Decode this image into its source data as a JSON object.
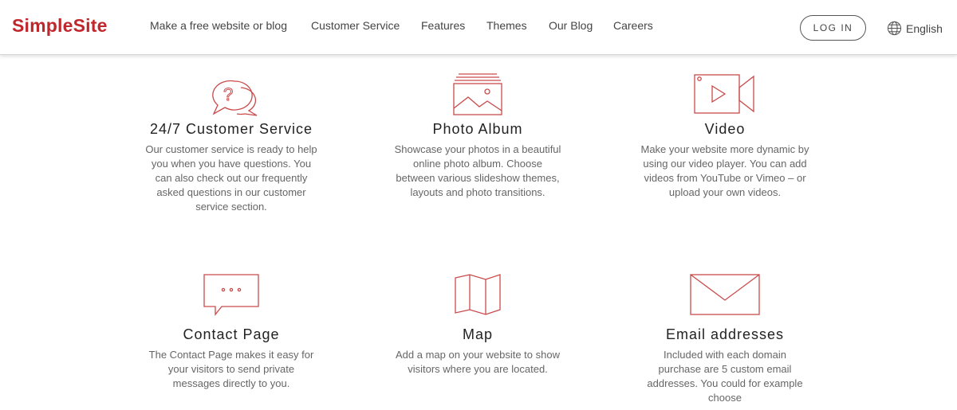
{
  "header": {
    "logo": "SimpleSite",
    "nav": [
      "Make a free website or blog",
      "Customer Service",
      "Features",
      "Themes",
      "Our Blog",
      "Careers"
    ],
    "login_label": "LOG IN",
    "language": "English"
  },
  "features": [
    {
      "icon": "speech-bubbles-question-icon",
      "title": "24/7 Customer Service",
      "description": "Our customer service is ready to help you when you have questions. You can also check out our frequently asked questions in our customer service section."
    },
    {
      "icon": "photo-album-icon",
      "title": "Photo Album",
      "description": "Showcase your photos in a beautiful online photo album. Choose between various slideshow themes, layouts and photo transitions."
    },
    {
      "icon": "video-camera-icon",
      "title": "Video",
      "description": "Make your website more dynamic by using our video player. You can add videos from YouTube or Vimeo – or upload your own videos."
    },
    {
      "icon": "chat-bubble-icon",
      "title": "Contact Page",
      "description": "The Contact Page makes it easy for your visitors to send private messages directly to you."
    },
    {
      "icon": "folded-map-icon",
      "title": "Map",
      "description": "Add a map on your website to show visitors where you are located."
    },
    {
      "icon": "envelope-icon",
      "title": "Email addresses",
      "description": "Included with each domain purchase are 5 custom email addresses. You could for example choose"
    }
  ],
  "colors": {
    "brand": "#c0272d",
    "icon_stroke": "#c94a4a"
  }
}
